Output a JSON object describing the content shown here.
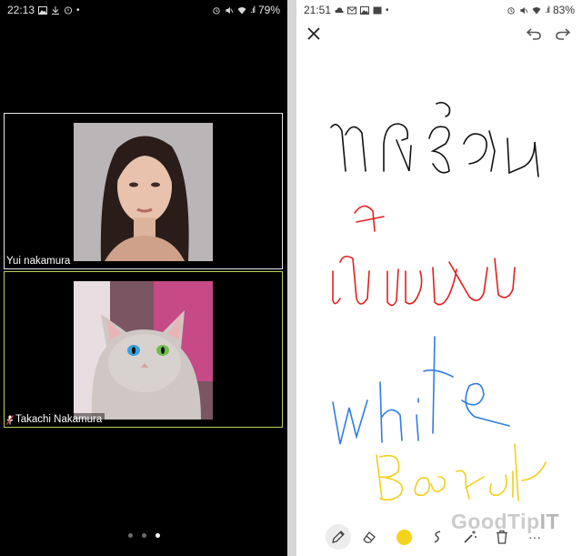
{
  "left_phone": {
    "status": {
      "time": "22:13",
      "battery": "79%",
      "signal": ".ıl"
    },
    "participants": [
      {
        "name": "Yui nakamura",
        "muted": false
      },
      {
        "name": "Takachi Nakamura",
        "muted": true
      }
    ],
    "page_indicator": {
      "pages": 3,
      "current": 3
    },
    "icons": [
      "photo-icon",
      "notification-icon",
      "alarm-icon",
      "mute-icon",
      "wifi-icon",
      "signal-icon",
      "mic-muted-icon"
    ]
  },
  "right_phone": {
    "status": {
      "time": "21:51",
      "battery": "83%",
      "signal": ".ıl"
    },
    "header": {
      "close": "×",
      "undo": "↶",
      "redo": "↷"
    },
    "whiteboard": {
      "strokes": [
        {
          "word": "ทดสอบ",
          "color": "#111111"
        },
        {
          "word": "เขียน",
          "color": "#e02020"
        },
        {
          "word": "white",
          "color": "#2f7de1"
        },
        {
          "word": "Board",
          "color": "#f5d21d"
        }
      ]
    },
    "toolbar": {
      "tools": [
        "pen-tool",
        "eraser-tool",
        "color-swatch",
        "stroke-width-tool",
        "magic-wand-tool",
        "delete-tool",
        "more-tool"
      ],
      "selected_tool": "pen-tool",
      "color": "#f5d21d",
      "more_label": "···"
    },
    "watermark": {
      "part1": "GoodTip",
      "part2": "IT"
    }
  }
}
